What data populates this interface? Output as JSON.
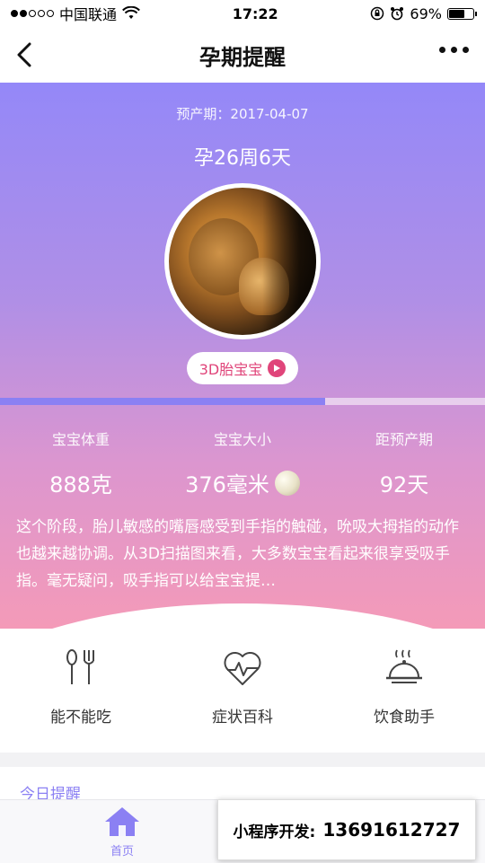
{
  "status_bar": {
    "carrier": "中国联通",
    "time": "17:22",
    "battery": "69%",
    "battery_level": 0.69
  },
  "nav": {
    "title": "孕期提醒"
  },
  "hero": {
    "due_date": "预产期：2017-04-07",
    "pregnancy_week": "孕26周6天",
    "video_button": "3D胎宝宝",
    "progress": 0.67
  },
  "stats": [
    {
      "label": "宝宝体重",
      "value": "888克"
    },
    {
      "label": "宝宝大小",
      "value": "376毫米"
    },
    {
      "label": "距预产期",
      "value": "92天"
    }
  ],
  "description": "这个阶段，胎儿敏感的嘴唇感受到手指的触碰，吮吸大拇指的动作也越来越协调。从3D扫描图来看，大多数宝宝看起来很享受吸手指。毫无疑问，吸手指可以给宝宝提…",
  "tools": [
    {
      "label": "能不能吃",
      "icon": "utensils-icon"
    },
    {
      "label": "症状百科",
      "icon": "heart-pulse-icon"
    },
    {
      "label": "饮食助手",
      "icon": "cloche-icon"
    }
  ],
  "today_section": "今日提醒",
  "tab_bar": {
    "home_label": "首页"
  },
  "promo": {
    "label": "小程序开发:",
    "phone": "13691612727"
  },
  "colors": {
    "accent": "#8b80f3",
    "play": "#e0457a"
  }
}
